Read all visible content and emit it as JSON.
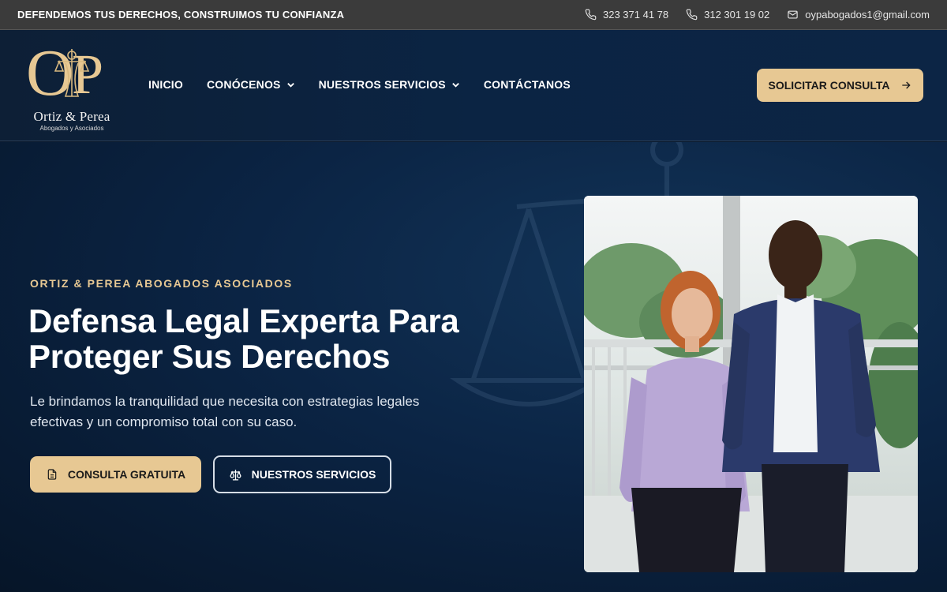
{
  "topbar": {
    "tagline": "DEFENDEMOS TUS DERECHOS, CONSTRUIMOS TU CONFIANZA",
    "phone1": "323 371 41 78",
    "phone2": "312 301 19 02",
    "email": "oypabogados1@gmail.com"
  },
  "logo": {
    "monogram_left": "O",
    "monogram_right": "P",
    "name": "Ortiz & Perea",
    "subtitle": "Abogados y Asociados"
  },
  "nav": {
    "items": [
      {
        "label": "INICIO",
        "dropdown": false
      },
      {
        "label": "CONÓCENOS",
        "dropdown": true
      },
      {
        "label": "NUESTROS SERVICIOS",
        "dropdown": true
      },
      {
        "label": "CONTÁCTANOS",
        "dropdown": false
      }
    ],
    "cta_label": "SOLICITAR CONSULTA"
  },
  "hero": {
    "eyebrow": "ORTIZ & PEREA ABOGADOS ASOCIADOS",
    "headline_line1": "Defensa Legal Experta Para",
    "headline_line2": "Proteger Sus Derechos",
    "lead_line1": "Le brindamos la tranquilidad que necesita con estrategias legales",
    "lead_line2": "efectivas y un compromiso total con su caso.",
    "primary_button": "CONSULTA GRATUITA",
    "secondary_button": "NUESTROS SERVICIOS"
  },
  "colors": {
    "accent_gold": "#e7c893",
    "topbar_bg": "#3b3b3b",
    "navy": "#0b2443"
  },
  "icons": {
    "phone": "phone-icon",
    "email": "mail-icon",
    "chevron": "chevron-down-icon",
    "arrow": "arrow-right-icon",
    "document": "document-icon",
    "scales": "scales-icon"
  }
}
